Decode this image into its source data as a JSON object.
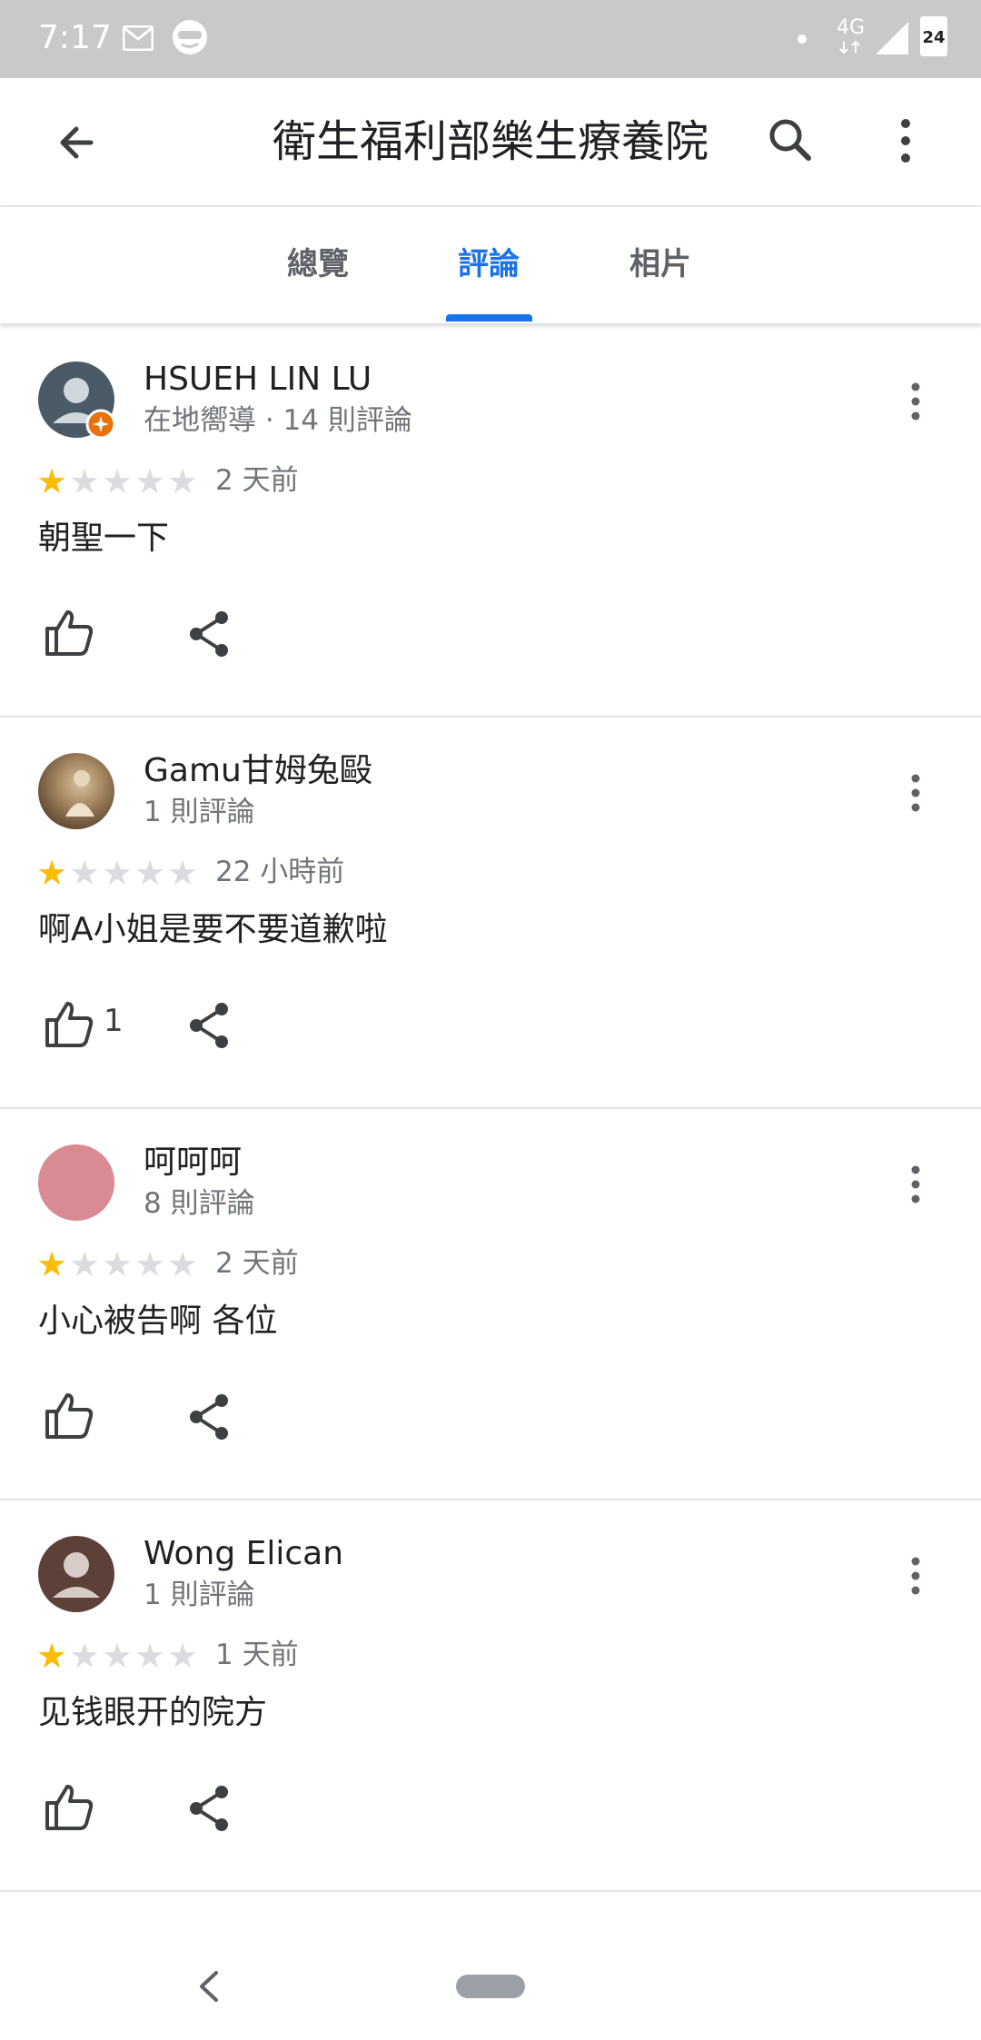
{
  "status_bar": {
    "time": "7:17",
    "network": "4G",
    "battery": "24",
    "icons": [
      "mail-icon",
      "app-notification-icon",
      "signal-icon",
      "battery-icon"
    ]
  },
  "app_bar": {
    "title": "衛生福利部樂生療養院",
    "icons": [
      "back-arrow-icon",
      "search-icon",
      "more-vert-icon"
    ]
  },
  "tabs": [
    {
      "label": "總覽",
      "active": false
    },
    {
      "label": "評論",
      "active": true
    },
    {
      "label": "相片",
      "active": false
    }
  ],
  "accent_color": "#1a73e8",
  "star_color": "#fbbc04",
  "reviews": [
    {
      "name": "HSUEH LIN LU",
      "meta": "在地嚮導 · 14 則評論",
      "rating": 1,
      "time": "2 天前",
      "text": "朝聖一下",
      "likes": "",
      "avatar": "default-avatar-local-guide",
      "avatar_color": "#4a5a66"
    },
    {
      "name": "Gamu甘姆兔毆",
      "meta": "1 則評論",
      "rating": 1,
      "time": "22 小時前",
      "text": "啊A小姐是要不要道歉啦",
      "likes": "1",
      "avatar": "photo-avatar",
      "avatar_color": "#8a6e4e"
    },
    {
      "name": "呵呵呵",
      "meta": "8 則評論",
      "rating": 1,
      "time": "2 天前",
      "text": "小心被告啊 各位",
      "likes": "",
      "avatar": "pink-avatar",
      "avatar_color": "#d98a92"
    },
    {
      "name": "Wong Elican",
      "meta": "1 則評論",
      "rating": 1,
      "time": "1 天前",
      "text": "见钱眼开的院方",
      "likes": "",
      "avatar": "default-avatar",
      "avatar_color": "#5d4037"
    }
  ],
  "nav_bar": {
    "icons": [
      "nav-back-icon",
      "home-pill"
    ]
  }
}
